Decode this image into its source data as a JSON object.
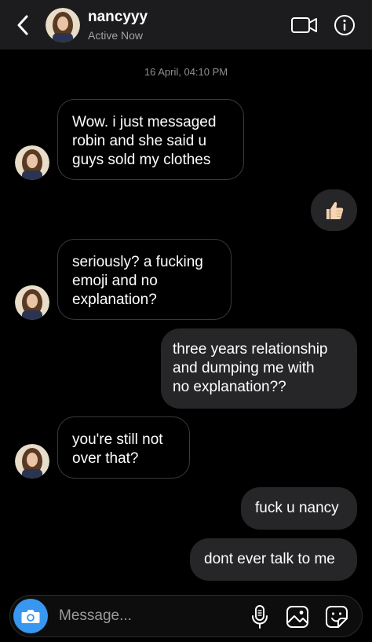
{
  "header": {
    "contact_name": "nancyyy",
    "status": "Active Now",
    "back_icon": "chevron-left-icon",
    "video_icon": "video-camera-icon",
    "info_icon": "info-icon"
  },
  "thread": {
    "timestamp": "16 April, 04:10 PM",
    "messages": [
      {
        "sender": "contact",
        "lines": [
          "Wow. i just messaged",
          "robin and she said u",
          "guys sold my clothes"
        ]
      },
      {
        "sender": "me",
        "emoji": "👍🏻"
      },
      {
        "sender": "contact",
        "lines": [
          "seriously? a fucking",
          "emoji and no",
          "explanation?"
        ]
      },
      {
        "sender": "me",
        "lines": [
          "three years relationship",
          "and dumping me with",
          "no explanation??"
        ]
      },
      {
        "sender": "contact",
        "lines": [
          "you're still not",
          "over that?"
        ]
      },
      {
        "sender": "me",
        "text": "fuck u nancy"
      },
      {
        "sender": "me",
        "text": "dont ever talk to me"
      }
    ]
  },
  "composer": {
    "placeholder": "Message...",
    "camera_icon": "camera-icon",
    "mic_icon": "microphone-icon",
    "gallery_icon": "gallery-icon",
    "sticker_icon": "sticker-icon"
  },
  "colors": {
    "background": "#000000",
    "header": "#1c1c1e",
    "outgoing_bubble": "#262628",
    "incoming_border": "#3a3a3c",
    "accent": "#3897f0",
    "secondary_text": "#8e8e93"
  }
}
